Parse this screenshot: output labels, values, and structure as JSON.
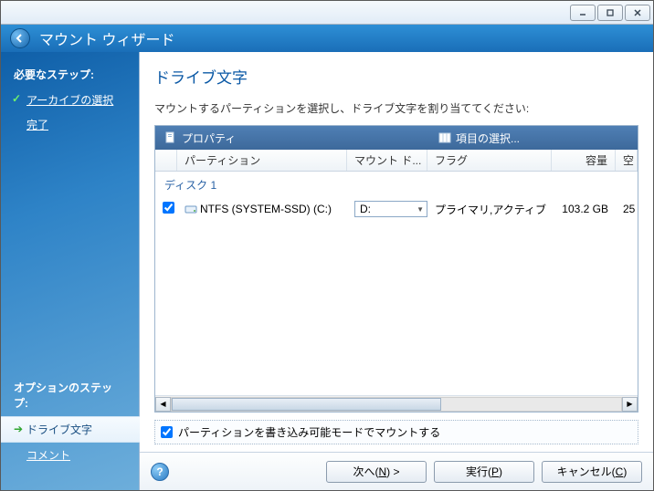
{
  "window": {
    "minimize": "—",
    "maximize": "▢",
    "close": "✕"
  },
  "header": {
    "title": "マウント ウィザード"
  },
  "sidebar": {
    "required_label": "必要なステップ:",
    "items": [
      {
        "label": "アーカイブの選択",
        "done": true
      },
      {
        "label": "完了",
        "done": false
      }
    ],
    "optional_label": "オプションのステップ:",
    "optional_items": [
      {
        "label": "ドライブ文字",
        "active": true
      },
      {
        "label": "コメント",
        "active": false
      }
    ]
  },
  "main": {
    "title": "ドライブ文字",
    "description": "マウントするパーティションを選択し、ドライブ文字を割り当ててください:",
    "toolbar": {
      "properties": "プロパティ",
      "select_columns": "項目の選択..."
    },
    "columns": {
      "partition": "パーティション",
      "mount": "マウント ド...",
      "flags": "フラグ",
      "capacity": "容量",
      "free": "空"
    },
    "disk_label": "ディスク 1",
    "row": {
      "checked": true,
      "name": "NTFS (SYSTEM-SSD) (C:)",
      "mount": "D:",
      "flags": "プライマリ,アクティブ",
      "capacity": "103.2 GB",
      "free": "25"
    },
    "writable": {
      "checked": true,
      "label": "パーティションを書き込み可能モードでマウントする"
    }
  },
  "footer": {
    "next_pre": "次へ(",
    "next_key": "N",
    "next_post": ") >",
    "exec_pre": "実行(",
    "exec_key": "P",
    "exec_post": ")",
    "cancel_pre": "キャンセル(",
    "cancel_key": "C",
    "cancel_post": ")"
  }
}
